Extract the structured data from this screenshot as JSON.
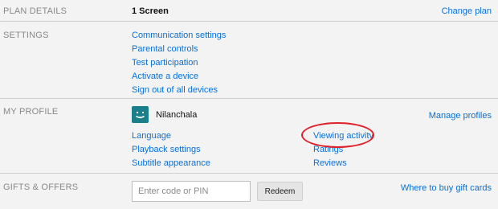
{
  "plan": {
    "label": "PLAN DETAILS",
    "value": "1 Screen",
    "change_link": "Change plan"
  },
  "settings": {
    "label": "SETTINGS",
    "links": [
      "Communication settings",
      "Parental controls",
      "Test participation",
      "Activate a device",
      "Sign out of all devices"
    ]
  },
  "profile": {
    "label": "MY PROFILE",
    "name": "Nilanchala",
    "avatar_icon": "smiley-face-icon",
    "avatar_color": "#1a7f8a",
    "manage_link": "Manage profiles",
    "left_links": [
      "Language",
      "Playback settings",
      "Subtitle appearance"
    ],
    "right_links": [
      "Viewing activity",
      "Ratings",
      "Reviews"
    ]
  },
  "annotation": {
    "highlighted_item": "Viewing activity",
    "color": "#e0202a"
  },
  "gifts": {
    "label": "GIFTS & OFFERS",
    "input_placeholder": "Enter code or PIN",
    "input_value": "",
    "redeem_label": "Redeem",
    "buy_link": "Where to buy gift cards"
  },
  "theme": {
    "link_color": "#0a70d6",
    "background": "#f3f3f3"
  }
}
